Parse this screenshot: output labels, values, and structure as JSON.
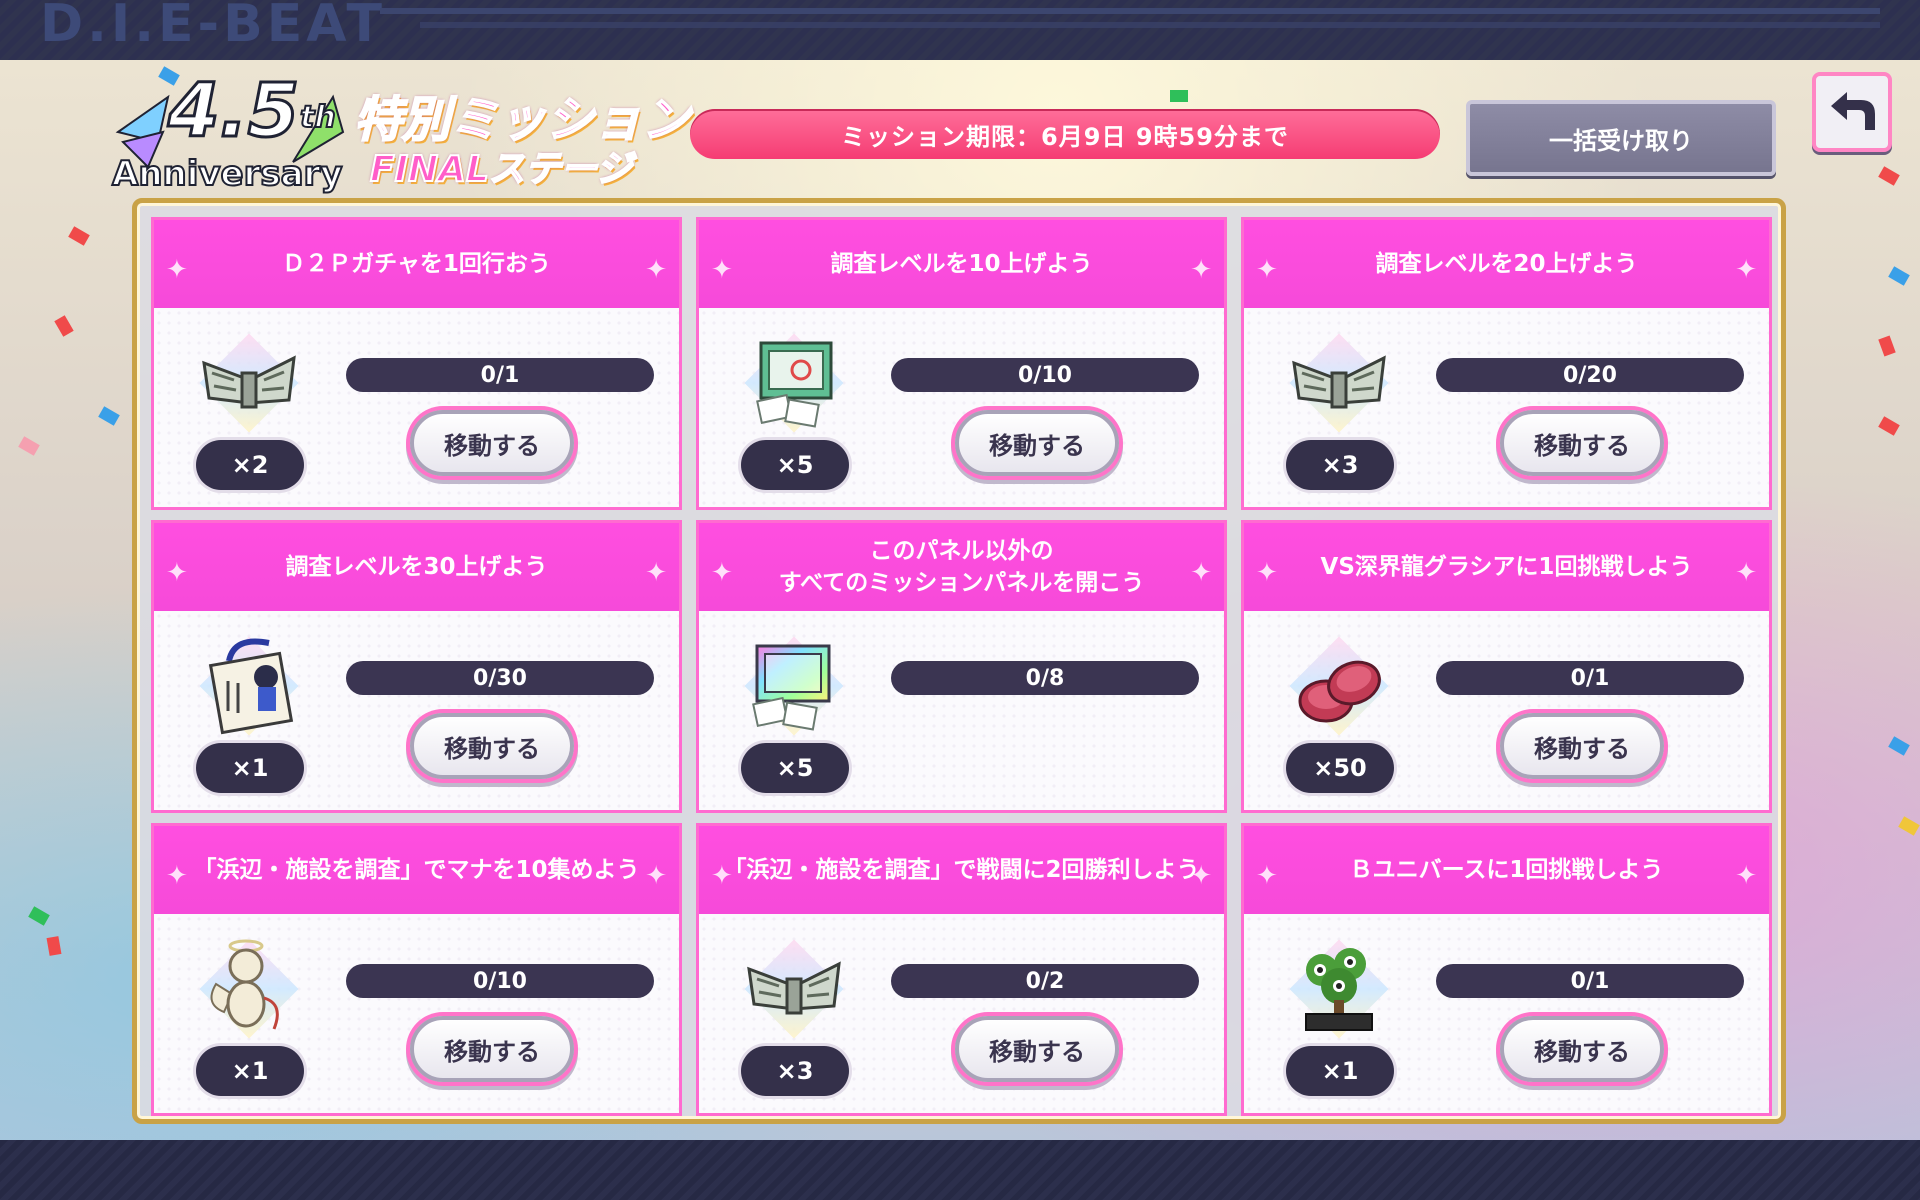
{
  "brand": "D.I.E-BEAT",
  "header": {
    "logo_number": "4.5",
    "logo_suffix": "th",
    "logo_anniversary": "Anniversary",
    "title_line1": "特別ミッション",
    "title_line2": "FINALステージ",
    "deadline": "ミッション期限：6月9日 9時59分まで",
    "claim_all_label": "一括受け取り"
  },
  "icons": {
    "back": "back-arrow-icon",
    "gacha_ticket": "gacha-ticket-icon",
    "research_box": "research-box-icon",
    "charm": "charm-icon",
    "rainbow_box": "rainbow-box-icon",
    "coin": "coin-icon",
    "cupid": "cupid-figure-icon",
    "bonsai": "eyeball-bonsai-icon"
  },
  "colors": {
    "card_header": "#f64ad9",
    "deadline_bg": "#f53c73",
    "board_border": "#c9a246",
    "progress_bg": "#3b3552"
  },
  "missions": [
    {
      "title": "Ｄ２Ｐガチャを1回行おう",
      "icon": "gacha-ticket-icon",
      "qty": "×2",
      "progress": "0/1",
      "button": "移動する"
    },
    {
      "title": "調査レベルを10上げよう",
      "icon": "research-box-icon",
      "qty": "×5",
      "progress": "0/10",
      "button": "移動する"
    },
    {
      "title": "調査レベルを20上げよう",
      "icon": "gacha-ticket-icon",
      "qty": "×3",
      "progress": "0/20",
      "button": "移動する"
    },
    {
      "title": "調査レベルを30上げよう",
      "icon": "charm-icon",
      "qty": "×1",
      "progress": "0/30",
      "button": "移動する"
    },
    {
      "title": "このパネル以外の\nすべてのミッションパネルを開こう",
      "icon": "rainbow-box-icon",
      "qty": "×5",
      "progress": "0/8",
      "button": ""
    },
    {
      "title": "VS深界龍グラシアに1回挑戦しよう",
      "icon": "coin-icon",
      "qty": "×50",
      "progress": "0/1",
      "button": "移動する"
    },
    {
      "title": "「浜辺・施設を調査」でマナを10集めよう",
      "icon": "cupid-figure-icon",
      "qty": "×1",
      "progress": "0/10",
      "button": "移動する"
    },
    {
      "title": "「浜辺・施設を調査」で戦闘に2回勝利しよう",
      "icon": "gacha-ticket-icon",
      "qty": "×3",
      "progress": "0/2",
      "button": "移動する"
    },
    {
      "title": "Ｂユニバースに1回挑戦しよう",
      "icon": "eyeball-bonsai-icon",
      "qty": "×1",
      "progress": "0/1",
      "button": "移動する"
    }
  ]
}
